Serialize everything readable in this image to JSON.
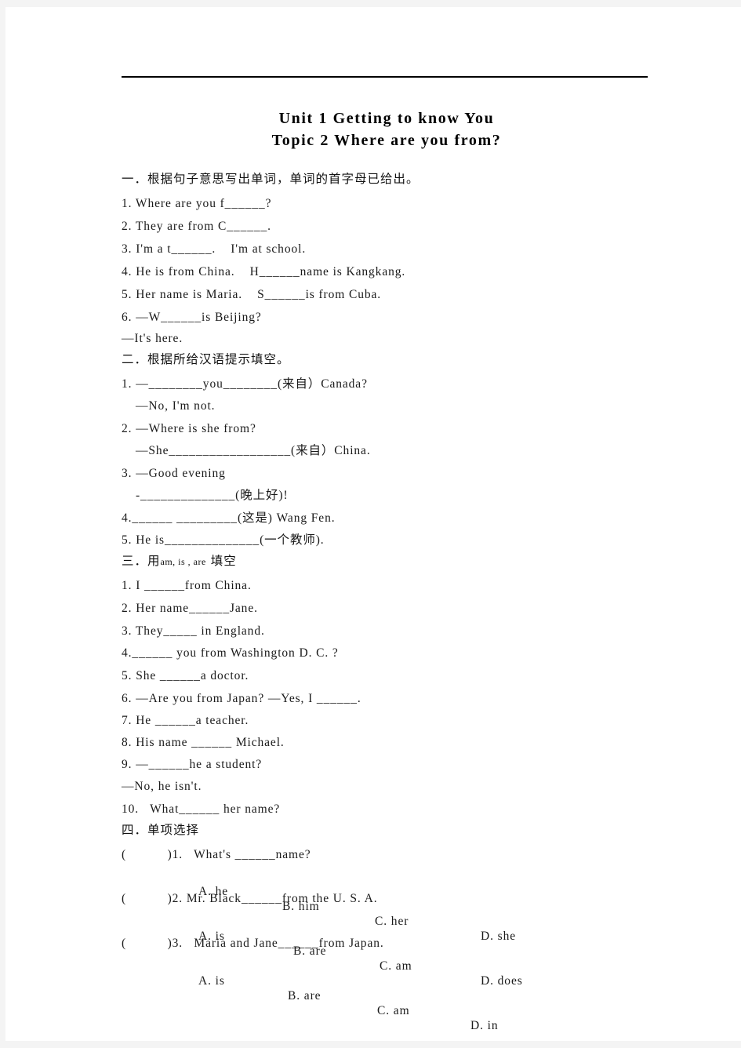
{
  "document": {
    "page_background": "#ffffff",
    "margin_background": "#f4f4f4",
    "text_color": "#1a1a1a",
    "title_line_1": "Unit 1 Getting to know You",
    "title_line_2": "Topic 2 Where are you from?"
  },
  "sections": [
    {
      "id": "section-1",
      "heading": "一．根据句子意思写出单词，单词的首字母已给出。",
      "items": [
        "1. Where are you f______?",
        "2. They are from C______.",
        "3. I'm a t______.    I'm at school.",
        "4. He is from China.    H______name is Kangkang.",
        "5. Her name is Maria.    S______is from Cuba.",
        "6. —W______is Beijing?",
        "—It's here."
      ]
    },
    {
      "id": "section-2",
      "heading": "二．根据所给汉语提示填空。",
      "items": [
        "1. —________you________(来自）Canada?",
        "—No, I'm not.",
        "2. —Where is she from?",
        "—She__________________(来自）China.",
        "3. —Good evening",
        "-______________(晚上好)!",
        "4.______ _________(这是) Wang Fen.",
        "5. He is______________(一个教师)."
      ]
    },
    {
      "id": "section-3",
      "heading": "三．用am, is , are 填空",
      "heading_cn_prefix": "三．用",
      "heading_inline_en": "am, is , are",
      "heading_cn_suffix": " 填空",
      "items": [
        "1. I ______from China.",
        "2. Her name______Jane.",
        "3. They_____ in England.",
        "4.______ you from Washington D. C. ?",
        "5. She ______a doctor.",
        "6. —Are you from Japan? —Yes, I ______.",
        "7. He ______a teacher.",
        "8. His name ______ Michael.",
        "9. —______he a student?",
        "—No, he isn't.",
        "10.   What______ her name?"
      ]
    },
    {
      "id": "section-4",
      "heading": "四．单项选择",
      "questions": [
        {
          "stem": "(           )1.   What's ______name?",
          "options": [
            "A. he",
            "B. him",
            "C. her",
            "D. she"
          ]
        },
        {
          "stem": "(           )2. Mr. Black______from the U. S. A.",
          "options": [
            "A. is",
            "B. are",
            "C. am",
            "D. does"
          ]
        },
        {
          "stem": "(           )3.   Maria and Jane______from Japan.",
          "options": [
            "A. is",
            "B. are",
            "C. am",
            "D. in"
          ]
        }
      ]
    }
  ]
}
